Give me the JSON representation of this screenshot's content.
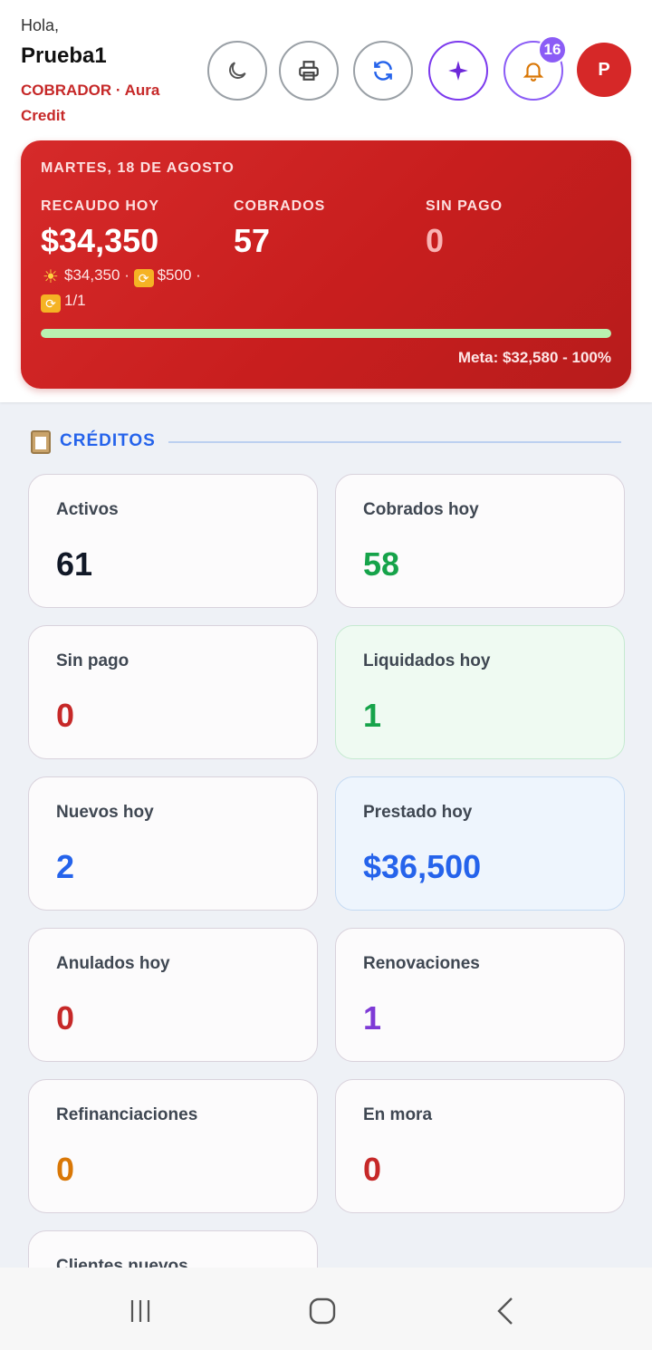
{
  "header": {
    "greeting": "Hola,",
    "user_name": "Prueba1",
    "role_line": "COBRADOR · Aura Credit",
    "notification_count": "16",
    "avatar_initial": "P"
  },
  "summary": {
    "date": "MARTES, 18 DE AGOSTO",
    "recaudo_label": "RECAUDO HOY",
    "recaudo_value": "$34,350",
    "cobrados_label": "COBRADOS",
    "cobrados_value": "57",
    "sinpago_label": "SIN PAGO",
    "sinpago_value": "0",
    "breakdown_cash": "$34,350",
    "breakdown_sep1": "·",
    "breakdown_renewal": "$500",
    "breakdown_sep2": "·",
    "breakdown_count": "1/1",
    "progress_percent": 100,
    "meta_text": "Meta: $32,580 - 100%",
    "progress_color": "#b9f0b0"
  },
  "section": {
    "title": "CRÉDITOS"
  },
  "cards": [
    {
      "label": "Activos",
      "value": "61",
      "color": "#111827"
    },
    {
      "label": "Cobrados hoy",
      "value": "58",
      "color": "#16a34a"
    },
    {
      "label": "Sin pago",
      "value": "0",
      "color": "#c62828"
    },
    {
      "label": "Liquidados hoy",
      "value": "1",
      "color": "#16a34a"
    },
    {
      "label": "Nuevos hoy",
      "value": "2",
      "color": "#2563eb"
    },
    {
      "label": "Prestado hoy",
      "value": "$36,500",
      "color": "#2563eb"
    },
    {
      "label": "Anulados hoy",
      "value": "0",
      "color": "#c62828"
    },
    {
      "label": "Renovaciones",
      "value": "1",
      "color": "#7e3ad6"
    },
    {
      "label": "Refinanciaciones",
      "value": "0",
      "color": "#d97706"
    },
    {
      "label": "En mora",
      "value": "0",
      "color": "#c62828"
    },
    {
      "label": "Clientes nuevos",
      "value": "",
      "color": "#111827"
    }
  ],
  "icons": {
    "theme": "moon-icon",
    "print": "printer-icon",
    "sync": "refresh-icon",
    "ai": "sparkle-icon",
    "notifications": "bell-icon"
  }
}
